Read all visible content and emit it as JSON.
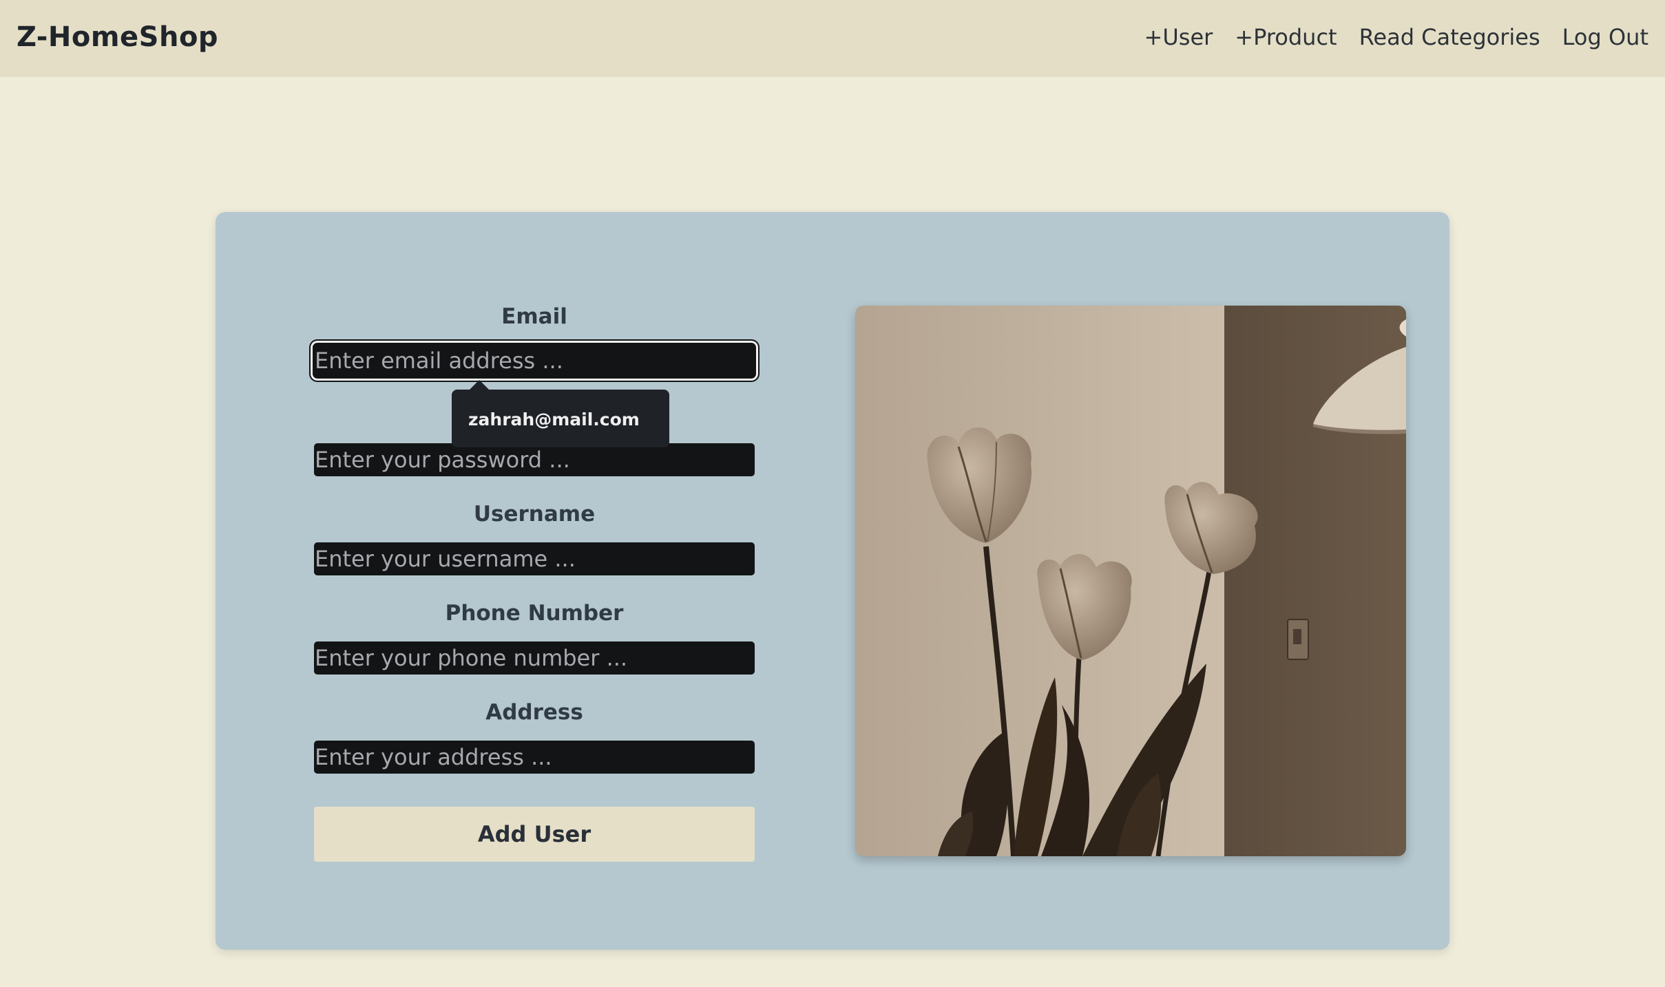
{
  "nav": {
    "brand": "Z-HomeShop",
    "links": [
      "+User",
      "+Product",
      "Read Categories",
      "Log Out"
    ]
  },
  "form": {
    "email": {
      "label": "Email",
      "placeholder": "Enter email address ..."
    },
    "password": {
      "placeholder": "Enter your password ..."
    },
    "username": {
      "label": "Username",
      "placeholder": "Enter your username ..."
    },
    "phone": {
      "label": "Phone Number",
      "placeholder": "Enter your phone number ..."
    },
    "address": {
      "label": "Address",
      "placeholder": "Enter your address ..."
    },
    "submit_label": "Add User",
    "autocomplete_suggestion": "zahrah@mail.com"
  },
  "colors": {
    "page_background": "#f0ecda",
    "navbar_background": "#e4dec6",
    "card_background": "#b5c8cf",
    "input_background": "#131416",
    "button_background": "#e6dfc8"
  },
  "image": {
    "subject": "sepia-toned-tulips-photo"
  }
}
